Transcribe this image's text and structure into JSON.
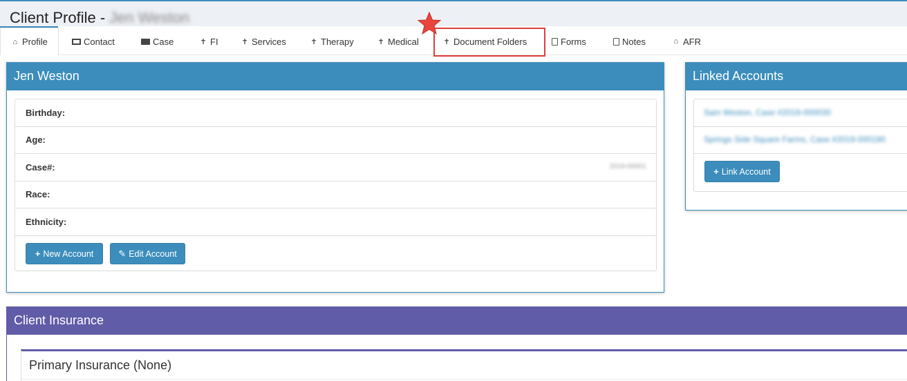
{
  "page": {
    "title": "Client Profile -",
    "client_name": "Jen Weston"
  },
  "tabs": [
    {
      "label": "Profile",
      "icon": "home-icon"
    },
    {
      "label": "Contact",
      "icon": "id-card-icon"
    },
    {
      "label": "Case",
      "icon": "briefcase-icon"
    },
    {
      "label": "FI",
      "icon": "person-icon"
    },
    {
      "label": "Services",
      "icon": "person-icon"
    },
    {
      "label": "Therapy",
      "icon": "person-icon"
    },
    {
      "label": "Medical",
      "icon": "person-icon"
    },
    {
      "label": "Document Folders",
      "icon": "person-icon"
    },
    {
      "label": "Forms",
      "icon": "file-icon"
    },
    {
      "label": "Notes",
      "icon": "file-icon"
    },
    {
      "label": "AFR",
      "icon": "home-icon"
    }
  ],
  "profile_panel": {
    "title": "Jen Weston",
    "fields": [
      {
        "label": "Birthday:",
        "value": ""
      },
      {
        "label": "Age:",
        "value": ""
      },
      {
        "label": "Case#:",
        "value": "2019-00001"
      },
      {
        "label": "Race:",
        "value": ""
      },
      {
        "label": "Ethnicity:",
        "value": ""
      }
    ],
    "new_account_label": "New Account",
    "edit_account_label": "Edit Account"
  },
  "linked_accounts": {
    "title": "Linked Accounts",
    "items": [
      "Sam Weston, Case #2019-000030",
      "Springs Side Square Farms, Case #2019-000180"
    ],
    "link_account_label": "Link Account"
  },
  "insurance": {
    "title": "Client Insurance",
    "primary_title": "Primary Insurance (None)"
  },
  "colors": {
    "primary": "#3c8dbc",
    "insurance": "#605ca8",
    "highlight": "#e03c3c"
  }
}
